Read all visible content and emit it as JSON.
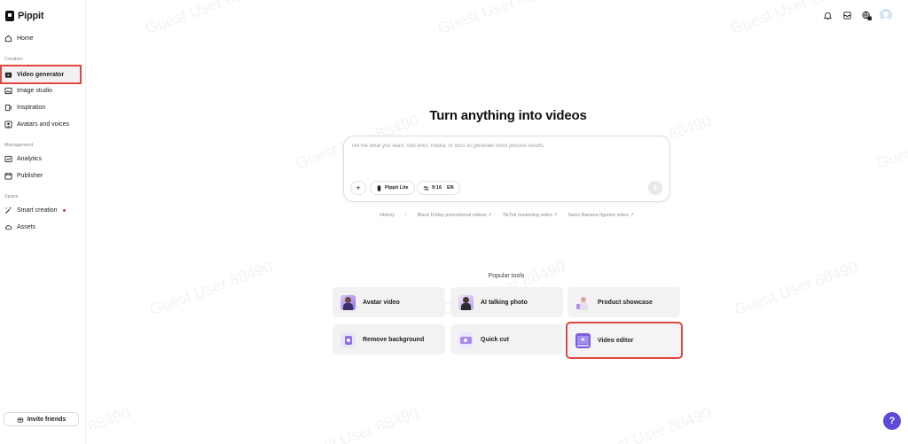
{
  "app": {
    "name": "Pippit"
  },
  "sidebar": {
    "home": "Home",
    "sections": {
      "creation": "Creation",
      "management": "Management",
      "space": "Space"
    },
    "creation_items": [
      {
        "label": "Video generator",
        "icon": "video-generator-icon",
        "active": true
      },
      {
        "label": "Image studio",
        "icon": "image-icon"
      },
      {
        "label": "Inspiration",
        "icon": "lightbulb-icon"
      },
      {
        "label": "Avatars and voices",
        "icon": "avatar-icon"
      }
    ],
    "management_items": [
      {
        "label": "Analytics",
        "icon": "chart-icon"
      },
      {
        "label": "Publisher",
        "icon": "calendar-icon"
      }
    ],
    "space_items": [
      {
        "label": "Smart creation",
        "icon": "magic-wand-icon",
        "badge": "new-dot"
      },
      {
        "label": "Assets",
        "icon": "cloud-icon"
      }
    ],
    "invite": "Invite friends"
  },
  "topbar": {
    "icons": [
      "bell-icon",
      "inbox-icon",
      "language-icon",
      "avatar"
    ]
  },
  "hero": {
    "title": "Turn anything into videos"
  },
  "prompt": {
    "placeholder": "Tell me what you want. Add links, media, or docs to generate more precise results.",
    "plus": "+",
    "model": "Pippit Lite",
    "ratio": "9:16",
    "language": "EN"
  },
  "suggestions": {
    "history": "History",
    "separator": "|",
    "items": [
      "Black Friday promotional videos ↗",
      "TikTok marketing video ↗",
      "Nano Banana figurine video ↗"
    ]
  },
  "popular": {
    "label": "Popular tools",
    "tools": [
      {
        "label": "Avatar video",
        "icon": "avatar-video-thumb"
      },
      {
        "label": "AI talking photo",
        "icon": "talking-photo-thumb"
      },
      {
        "label": "Product showcase",
        "icon": "product-showcase-thumb"
      },
      {
        "label": "Remove background",
        "icon": "remove-background-thumb"
      },
      {
        "label": "Quick cut",
        "icon": "quick-cut-thumb"
      },
      {
        "label": "Video editor",
        "icon": "video-editor-thumb",
        "highlighted": true
      }
    ]
  },
  "help": {
    "label": "?"
  },
  "watermark": "Guest User 88490",
  "colors": {
    "accent": "#5b4bd9",
    "highlight_border": "#e0473e",
    "card_bg": "#f2f2f2"
  }
}
